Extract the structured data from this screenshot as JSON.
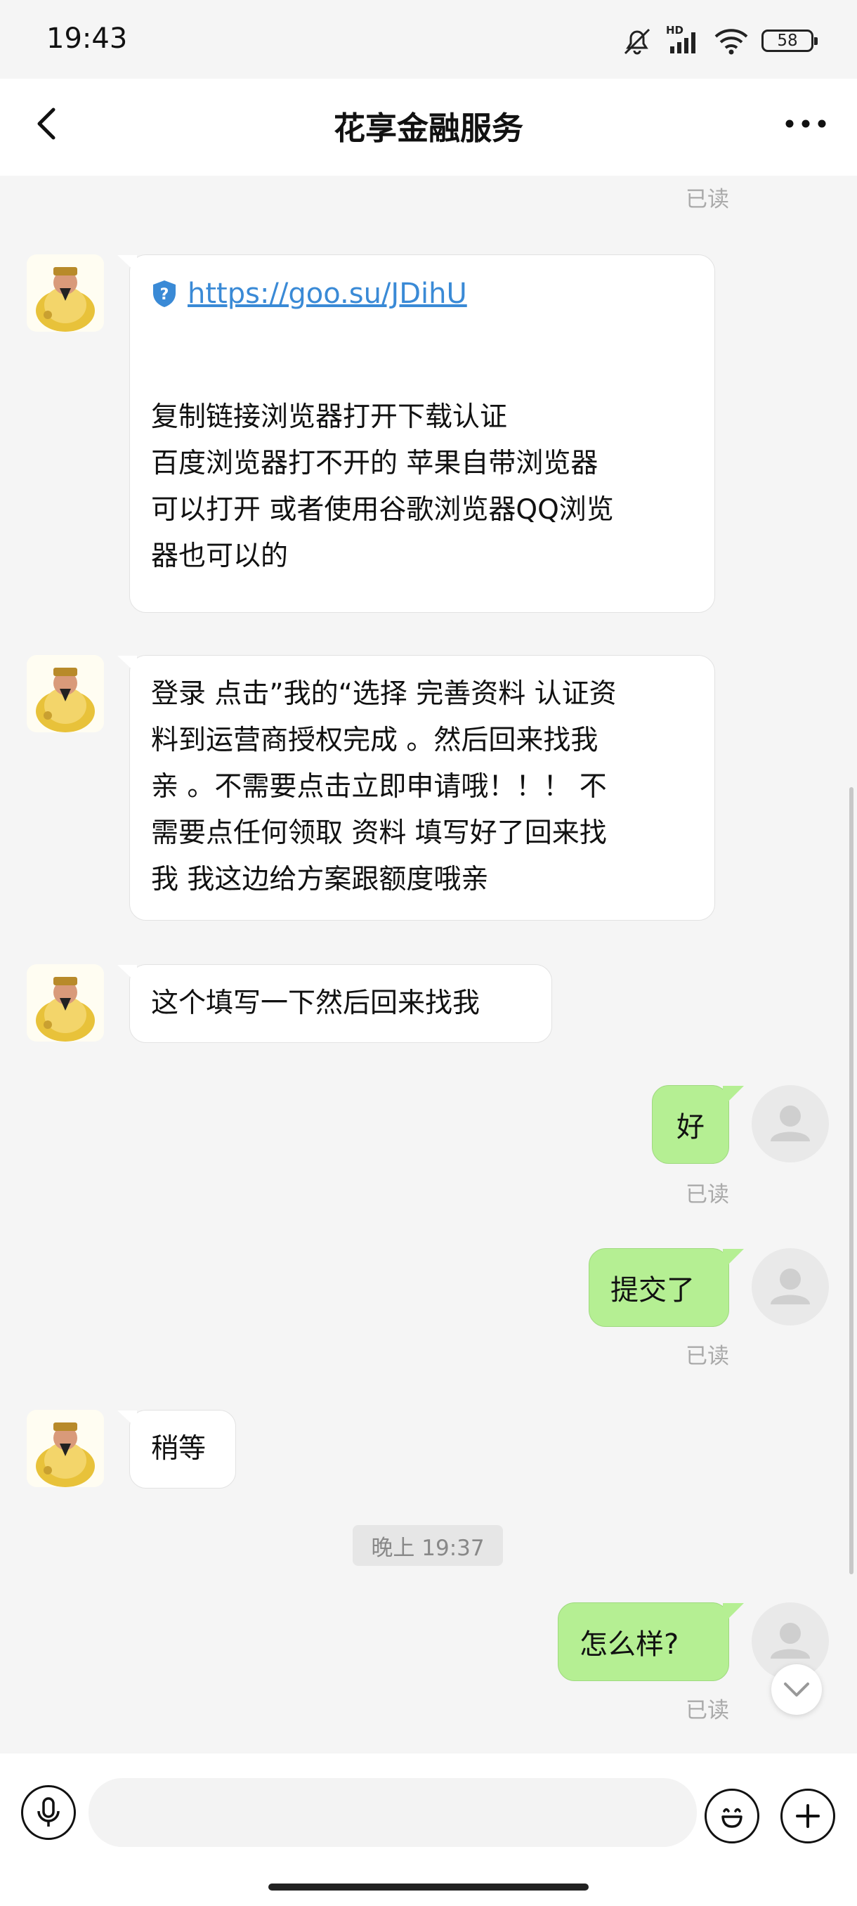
{
  "status_bar": {
    "time": "19:43",
    "battery": "58",
    "network": "HD"
  },
  "header": {
    "title": "花享金融服务"
  },
  "messages": [
    {
      "type": "read",
      "text": "已读"
    },
    {
      "type": "in",
      "link": "https://goo.su/JDihU",
      "lines": [
        "复制链接浏览器打开下载认证",
        "百度浏览器打不开的 苹果自带浏览器",
        "可以打开 或者使用谷歌浏览器QQ浏览",
        "器也可以的"
      ]
    },
    {
      "type": "in",
      "lines": [
        "登录 点击”我的“选择 完善资料 认证资",
        "料到运营商授权完成 。然后回来找我",
        "亲 。不需要点击立即申请哦！！！ 不",
        "需要点任何领取 资料 填写好了回来找",
        "我 我这边给方案跟额度哦亲"
      ]
    },
    {
      "type": "in",
      "text": "这个填写一下然后回来找我"
    },
    {
      "type": "out",
      "text": "好",
      "read": "已读"
    },
    {
      "type": "out",
      "text": "提交了",
      "read": "已读"
    },
    {
      "type": "in",
      "text": "稍等"
    },
    {
      "type": "time",
      "text": "晚上 19:37"
    },
    {
      "type": "out",
      "text": "怎么样?",
      "read": "已读"
    }
  ],
  "input": {
    "placeholder": ""
  },
  "icons": {
    "back": "back-arrow-icon",
    "more": "more-dots-icon",
    "voice": "microphone-icon",
    "emoji": "emoji-icon",
    "add": "plus-icon",
    "shield": "shield-question-icon"
  },
  "colors": {
    "out_bubble": "#b5ef93",
    "in_bubble": "#ffffff",
    "link": "#3a8ad6",
    "background": "#f5f5f5"
  }
}
